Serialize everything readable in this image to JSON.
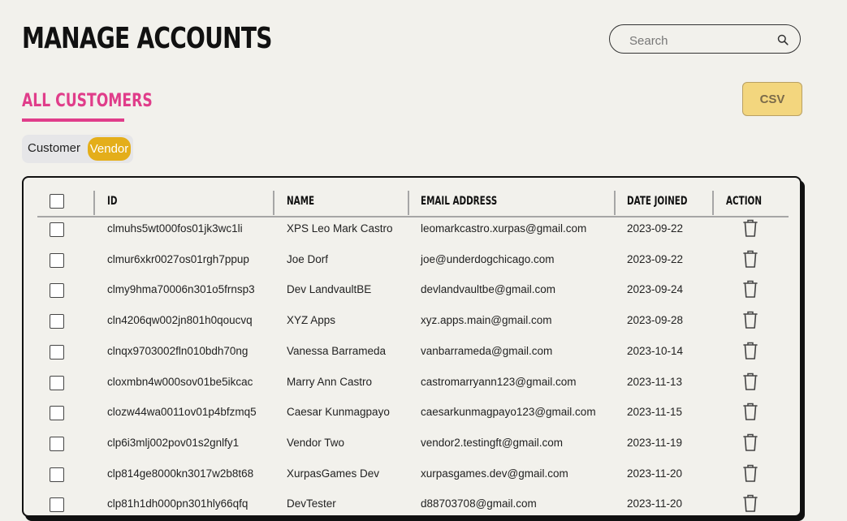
{
  "header": {
    "title": "MANAGE ACCOUNTS",
    "search": {
      "placeholder": "Search",
      "value": "",
      "icon": "search-icon"
    }
  },
  "section": {
    "title": "ALL CUSTOMERS",
    "accent_color": "#e03d8a"
  },
  "csv_button": {
    "label": "CSV",
    "color": "#f3d67e"
  },
  "toggle": {
    "options": [
      "Customer",
      "Vendor"
    ],
    "selected": "Vendor",
    "active_color": "#e4ae1a"
  },
  "table": {
    "columns": [
      "ID",
      "NAME",
      "EMAIL ADDRESS",
      "DATE JOINED",
      "ACTION"
    ],
    "action_icon": "trash-icon",
    "rows": [
      {
        "id": "clmuhs5wt000fos01jk3wc1li",
        "name": "XPS Leo Mark Castro",
        "email": "leomarkcastro.xurpas@gmail.com",
        "date": "2023-09-22"
      },
      {
        "id": "clmur6xkr0027os01rgh7ppup",
        "name": "Joe Dorf",
        "email": "joe@underdogchicago.com",
        "date": "2023-09-22"
      },
      {
        "id": "clmy9hma70006n301o5frnsp3",
        "name": "Dev LandvaultBE",
        "email": "devlandvaultbe@gmail.com",
        "date": "2023-09-24"
      },
      {
        "id": "cln4206qw002jn801h0qoucvq",
        "name": "XYZ Apps",
        "email": "xyz.apps.main@gmail.com",
        "date": "2023-09-28"
      },
      {
        "id": "clnqx9703002fln010bdh70ng",
        "name": "Vanessa Barrameda",
        "email": "vanbarrameda@gmail.com",
        "date": "2023-10-14"
      },
      {
        "id": "cloxmbn4w000sov01be5ikcac",
        "name": "Marry Ann Castro",
        "email": "castromarryann123@gmail.com",
        "date": "2023-11-13"
      },
      {
        "id": "clozw44wa0011ov01p4bfzmq5",
        "name": "Caesar Kunmagpayo",
        "email": "caesarkunmagpayo123@gmail.com",
        "date": "2023-11-15"
      },
      {
        "id": "clp6i3mlj002pov01s2gnlfy1",
        "name": "Vendor Two",
        "email": "vendor2.testingft@gmail.com",
        "date": "2023-11-19"
      },
      {
        "id": "clp814ge8000kn3017w2b8t68",
        "name": "XurpasGames Dev",
        "email": "xurpasgames.dev@gmail.com",
        "date": "2023-11-20"
      },
      {
        "id": "clp81h1dh000pn301hly66qfq",
        "name": "DevTester",
        "email": "d88703708@gmail.com",
        "date": "2023-11-20"
      }
    ]
  }
}
